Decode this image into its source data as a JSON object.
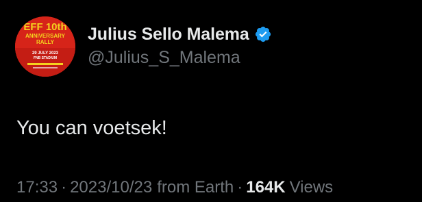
{
  "author": {
    "display_name": "Julius Sello Malema",
    "handle": "@Julius_S_Malema",
    "verified": true,
    "verified_badge_color": "#1d9bf0",
    "avatar": {
      "background_color": "#d62419",
      "text_lines": [
        "EFF 10th",
        "ANNIVERSARY",
        "RALLY",
        "29 JULY 2023",
        "FNB STADIUM"
      ]
    }
  },
  "tweet": {
    "text": "You can voetsek!"
  },
  "meta": {
    "time": "17:33",
    "separator": "·",
    "date": "2023/10/23",
    "source": "from Earth",
    "views_count": "164K",
    "views_label": "Views"
  },
  "colors": {
    "background": "#000000",
    "primary_text": "#e7e9ea",
    "secondary_text": "#71767b"
  }
}
